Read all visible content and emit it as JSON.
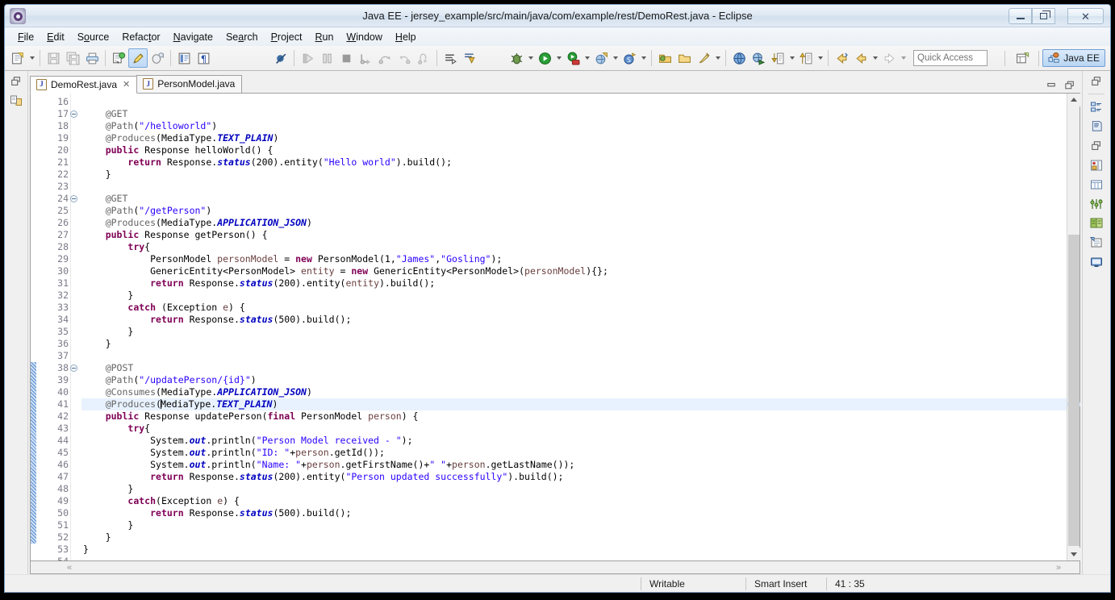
{
  "window": {
    "title": "Java EE - jersey_example/src/main/java/com/example/rest/DemoRest.java - Eclipse",
    "app_icon": "eclipse-icon",
    "minimize_label": "Minimize",
    "maximize_label": "Restore",
    "close_label": "Close"
  },
  "menubar": {
    "items": [
      {
        "label": "File",
        "mnemonic": "F"
      },
      {
        "label": "Edit",
        "mnemonic": "E"
      },
      {
        "label": "Source",
        "mnemonic": "o"
      },
      {
        "label": "Refactor",
        "mnemonic": "t"
      },
      {
        "label": "Navigate",
        "mnemonic": "N"
      },
      {
        "label": "Search",
        "mnemonic": "a"
      },
      {
        "label": "Project",
        "mnemonic": "P"
      },
      {
        "label": "Run",
        "mnemonic": "R"
      },
      {
        "label": "Window",
        "mnemonic": "W"
      },
      {
        "label": "Help",
        "mnemonic": "H"
      }
    ]
  },
  "toolbar": {
    "buttons": [
      {
        "name": "new-wizard-icon",
        "tooltip": "New"
      },
      {
        "name": "save-icon",
        "tooltip": "Save"
      },
      {
        "name": "save-all-icon",
        "tooltip": "Save All"
      },
      {
        "name": "print-icon",
        "tooltip": "Print"
      },
      {
        "name": "build-all-icon",
        "tooltip": "Build All"
      },
      {
        "name": "toggle-mark-occurrences-icon",
        "tooltip": "Toggle Mark Occurrences"
      },
      {
        "name": "new-java-class-icon",
        "tooltip": "New Java Class"
      },
      {
        "name": "open-type-icon",
        "tooltip": "Open Type"
      },
      {
        "name": "show-whitespace-icon",
        "tooltip": "Show Whitespace Characters"
      },
      {
        "name": "skip-all-breakpoints-icon",
        "tooltip": "Skip All Breakpoints"
      },
      {
        "name": "resume-icon",
        "tooltip": "Resume"
      },
      {
        "name": "suspend-icon",
        "tooltip": "Suspend"
      },
      {
        "name": "terminate-icon",
        "tooltip": "Terminate"
      },
      {
        "name": "step-into-icon",
        "tooltip": "Step Into"
      },
      {
        "name": "step-over-icon",
        "tooltip": "Step Over"
      },
      {
        "name": "step-return-icon",
        "tooltip": "Step Return"
      },
      {
        "name": "drop-to-frame-icon",
        "tooltip": "Drop To Frame"
      },
      {
        "name": "step-filters-icon",
        "tooltip": "Use Step Filters"
      },
      {
        "name": "step-debug-icon",
        "tooltip": "Step Debug"
      },
      {
        "name": "debug-icon",
        "tooltip": "Debug"
      },
      {
        "name": "run-icon",
        "tooltip": "Run"
      },
      {
        "name": "run-server-icon",
        "tooltip": "Run on Server"
      },
      {
        "name": "new-web-project-icon",
        "tooltip": "New Web Project"
      },
      {
        "name": "new-spring-icon",
        "tooltip": "New Element"
      },
      {
        "name": "open-package-icon",
        "tooltip": "Open Package"
      },
      {
        "name": "open-folder-icon",
        "tooltip": "Open Resource"
      },
      {
        "name": "quick-fix-icon",
        "tooltip": "Quick Fix"
      },
      {
        "name": "open-browser-icon",
        "tooltip": "Open Web Browser"
      },
      {
        "name": "external-tools-icon",
        "tooltip": "External Tools"
      },
      {
        "name": "next-annotation-icon",
        "tooltip": "Next Annotation"
      },
      {
        "name": "previous-annotation-icon",
        "tooltip": "Previous Annotation"
      },
      {
        "name": "back-icon",
        "tooltip": "Back"
      },
      {
        "name": "forward-icon",
        "tooltip": "Forward"
      }
    ],
    "quick_access_placeholder": "Quick Access",
    "open_perspective_icon": "open-perspective-icon",
    "perspective_label": "Java EE",
    "perspective_icon": "java-ee-perspective-icon"
  },
  "editor": {
    "tabs": [
      {
        "label": "DemoRest.java",
        "icon": "java-file-icon",
        "active": true,
        "closable": true
      },
      {
        "label": "PersonModel.java",
        "icon": "java-file-icon",
        "active": false,
        "closable": false
      }
    ],
    "minimize_icon": "minimize-editor-icon",
    "maximize_icon": "maximize-editor-icon",
    "first_line": 16,
    "cursor_line": 41,
    "lines": [
      {
        "n": 16,
        "fold": false,
        "changed": false,
        "html": ""
      },
      {
        "n": 17,
        "fold": true,
        "changed": false,
        "html": "    <span class=\"ann\">@GET</span>"
      },
      {
        "n": 18,
        "fold": false,
        "changed": false,
        "html": "    <span class=\"ann\">@Path</span>(<span class=\"str\">\"/helloworld\"</span>)"
      },
      {
        "n": 19,
        "fold": false,
        "changed": false,
        "html": "    <span class=\"ann\">@Produces</span>(MediaType.<span class=\"stat\">TEXT_PLAIN</span>)"
      },
      {
        "n": 20,
        "fold": false,
        "changed": false,
        "html": "    <span class=\"kw\">public</span> Response helloWorld() {"
      },
      {
        "n": 21,
        "fold": false,
        "changed": false,
        "html": "        <span class=\"kw\">return</span> Response.<span class=\"stat\">status</span>(200).entity(<span class=\"str\">\"Hello world\"</span>).build();"
      },
      {
        "n": 22,
        "fold": false,
        "changed": false,
        "html": "    }"
      },
      {
        "n": 23,
        "fold": false,
        "changed": false,
        "html": ""
      },
      {
        "n": 24,
        "fold": true,
        "changed": false,
        "html": "    <span class=\"ann\">@GET</span>"
      },
      {
        "n": 25,
        "fold": false,
        "changed": false,
        "html": "    <span class=\"ann\">@Path</span>(<span class=\"str\">\"/getPerson\"</span>)"
      },
      {
        "n": 26,
        "fold": false,
        "changed": false,
        "html": "    <span class=\"ann\">@Produces</span>(MediaType.<span class=\"stat\">APPLICATION_JSON</span>)"
      },
      {
        "n": 27,
        "fold": false,
        "changed": false,
        "html": "    <span class=\"kw\">public</span> Response getPerson() {"
      },
      {
        "n": 28,
        "fold": false,
        "changed": false,
        "html": "        <span class=\"kw\">try</span>{"
      },
      {
        "n": 29,
        "fold": false,
        "changed": false,
        "html": "            PersonModel <span class=\"loc\">personModel</span> = <span class=\"kw\">new</span> PersonModel(1,<span class=\"str\">\"James\"</span>,<span class=\"str\">\"Gosling\"</span>);"
      },
      {
        "n": 30,
        "fold": false,
        "changed": false,
        "html": "            GenericEntity&lt;PersonModel&gt; <span class=\"loc\">entity</span> = <span class=\"kw\">new</span> GenericEntity&lt;PersonModel&gt;(<span class=\"loc\">personModel</span>){};"
      },
      {
        "n": 31,
        "fold": false,
        "changed": false,
        "html": "            <span class=\"kw\">return</span> Response.<span class=\"stat\">status</span>(200).entity(<span class=\"loc\">entity</span>).build();"
      },
      {
        "n": 32,
        "fold": false,
        "changed": false,
        "html": "        }"
      },
      {
        "n": 33,
        "fold": false,
        "changed": false,
        "html": "        <span class=\"kw\">catch</span> (Exception <span class=\"loc\">e</span>) {"
      },
      {
        "n": 34,
        "fold": false,
        "changed": false,
        "html": "            <span class=\"kw\">return</span> Response.<span class=\"stat\">status</span>(500).build();"
      },
      {
        "n": 35,
        "fold": false,
        "changed": false,
        "html": "        }"
      },
      {
        "n": 36,
        "fold": false,
        "changed": false,
        "html": "    }"
      },
      {
        "n": 37,
        "fold": false,
        "changed": false,
        "html": ""
      },
      {
        "n": 38,
        "fold": true,
        "changed": true,
        "html": "    <span class=\"ann\">@POST</span>"
      },
      {
        "n": 39,
        "fold": false,
        "changed": true,
        "html": "    <span class=\"ann\">@Path</span>(<span class=\"str\">\"/updatePerson/{id}\"</span>)"
      },
      {
        "n": 40,
        "fold": false,
        "changed": true,
        "html": "    <span class=\"ann\">@Consumes</span>(MediaType.<span class=\"stat\">APPLICATION_JSON</span>)"
      },
      {
        "n": 41,
        "fold": false,
        "changed": true,
        "html": "    <span class=\"ann\">@Produces</span>(<span class=\"caret\"></span>MediaType.<span class=\"stat\">TEXT_PLAIN</span>)",
        "highlight": true
      },
      {
        "n": 42,
        "fold": false,
        "changed": true,
        "html": "    <span class=\"kw\">public</span> Response updatePerson(<span class=\"kw\">final</span> PersonModel <span class=\"loc\">person</span>) {"
      },
      {
        "n": 43,
        "fold": false,
        "changed": true,
        "html": "        <span class=\"kw\">try</span>{"
      },
      {
        "n": 44,
        "fold": false,
        "changed": true,
        "html": "            System.<span class=\"stat\">out</span>.println(<span class=\"str\">\"Person Model received - \"</span>);"
      },
      {
        "n": 45,
        "fold": false,
        "changed": true,
        "html": "            System.<span class=\"stat\">out</span>.println(<span class=\"str\">\"ID: \"</span>+<span class=\"loc\">person</span>.getId());"
      },
      {
        "n": 46,
        "fold": false,
        "changed": true,
        "html": "            System.<span class=\"stat\">out</span>.println(<span class=\"str\">\"Name: \"</span>+<span class=\"loc\">person</span>.getFirstName()+<span class=\"str\">\" \"</span>+<span class=\"loc\">person</span>.getLastName());"
      },
      {
        "n": 47,
        "fold": false,
        "changed": true,
        "html": "            <span class=\"kw\">return</span> Response.<span class=\"stat\">status</span>(200).entity(<span class=\"str\">\"Person updated successfully\"</span>).build();"
      },
      {
        "n": 48,
        "fold": false,
        "changed": true,
        "html": "        }"
      },
      {
        "n": 49,
        "fold": false,
        "changed": true,
        "html": "        <span class=\"kw\">catch</span>(Exception <span class=\"loc\">e</span>) {"
      },
      {
        "n": 50,
        "fold": false,
        "changed": true,
        "html": "            <span class=\"kw\">return</span> Response.<span class=\"stat\">status</span>(500).build();"
      },
      {
        "n": 51,
        "fold": false,
        "changed": true,
        "html": "        }"
      },
      {
        "n": 52,
        "fold": false,
        "changed": true,
        "html": "    }"
      },
      {
        "n": 53,
        "fold": false,
        "changed": false,
        "html": "}"
      },
      {
        "n": 54,
        "fold": false,
        "changed": false,
        "html": ""
      }
    ]
  },
  "left_rail": {
    "items": [
      {
        "name": "restore-view-icon",
        "label": "Restore"
      },
      {
        "name": "project-explorer-icon",
        "label": "Project Explorer"
      }
    ]
  },
  "right_rail": {
    "items": [
      {
        "name": "restore-view-icon",
        "label": "Restore"
      },
      {
        "name": "outline-view-icon",
        "label": "Outline"
      },
      {
        "name": "task-list-icon",
        "label": "Task List"
      },
      {
        "name": "restore-view2-icon",
        "label": "Restore"
      },
      {
        "name": "servers-view-icon",
        "label": "Servers"
      },
      {
        "name": "properties-view-icon",
        "label": "Properties"
      },
      {
        "name": "data-source-explorer-icon",
        "label": "Data Source Explorer"
      },
      {
        "name": "snippets-view-icon",
        "label": "Snippets"
      },
      {
        "name": "markers-view-icon",
        "label": "Markers"
      },
      {
        "name": "console-view-icon",
        "label": "Console"
      }
    ]
  },
  "statusbar": {
    "writable": "Writable",
    "insert_mode": "Smart Insert",
    "position": "41 : 35"
  },
  "colors": {
    "keyword": "#7f0055",
    "string": "#2a00ff",
    "annotation": "#646464",
    "static_field": "#0000c0",
    "local_var": "#6a3e3e",
    "highlight_line": "#e8f2fe",
    "accent": "#6f9fd4"
  }
}
